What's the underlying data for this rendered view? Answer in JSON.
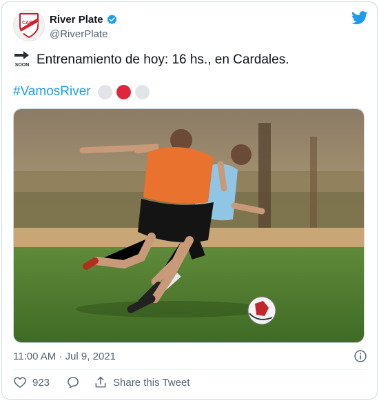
{
  "author": {
    "display_name": "River Plate",
    "handle": "@RiverPlate",
    "verified": true
  },
  "tweet": {
    "emoji": "soon-arrow-icon",
    "text": "Entrenamiento de hoy: 16 hs., en Cardales.",
    "hashtag": "#VamosRiver",
    "dot_colors": [
      "#e1e5e8",
      "#e0263a",
      "#e1e5e8"
    ]
  },
  "media": {
    "image": "photo-two-players-training"
  },
  "meta": {
    "timestamp": "11:00 AM · Jul 9, 2021"
  },
  "actions": {
    "like_count": "923",
    "share_label": "Share this Tweet"
  },
  "colors": {
    "accent": "#1d9bf0",
    "secondary_text": "#536471",
    "border": "#cfd9de"
  }
}
